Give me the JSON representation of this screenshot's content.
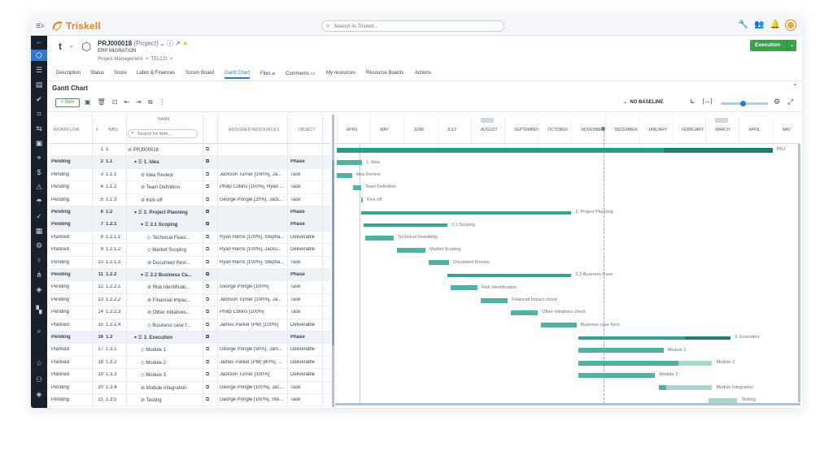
{
  "app": {
    "name": "Triskell",
    "search_placeholder": "Search in Triskell..."
  },
  "project": {
    "id": "PRJ000018",
    "type": "(Project)",
    "name": "ERP MIGRATION",
    "breadcrumbs": [
      "Project Management",
      "TELCO"
    ],
    "status_button": "Execution"
  },
  "tabs": [
    "Description",
    "Status",
    "Score",
    "Labor & Finances",
    "Scrum Board",
    "Gantt Chart",
    "Files",
    "Comments",
    "My resources",
    "Resource Boards",
    "Actions"
  ],
  "active_tab": "Gantt Chart",
  "section_title": "Gantt Chart",
  "toolbar": {
    "add_label": "+ Item",
    "baseline": "NO BASELINE"
  },
  "grid": {
    "headers": {
      "name": "NAME",
      "workflow": "WORKFLOW",
      "num": "#",
      "wbs": "WBS",
      "resources": "ASSIGNED RESOURCES",
      "object": "OBJECT"
    },
    "search_placeholder": "Search for item...",
    "rows": [
      {
        "workflow": "",
        "num": "1",
        "wbs": "1",
        "name": "PRJ000018",
        "resources": "",
        "object": "",
        "level": 0,
        "phase": false
      },
      {
        "workflow": "Pending",
        "num": "2",
        "wbs": "1.1",
        "name": "1. Idea",
        "resources": "",
        "object": "Phase",
        "level": 1,
        "phase": true
      },
      {
        "workflow": "Pending",
        "num": "3",
        "wbs": "1.1.1",
        "name": "Idea Review",
        "resources": "Jackson Turner [100%], Ja...",
        "object": "Task",
        "level": 2,
        "phase": false
      },
      {
        "workflow": "Pending",
        "num": "4",
        "wbs": "1.1.2",
        "name": "Team Definition",
        "resources": "Philip Collins [100%], Ryan ...",
        "object": "Task",
        "level": 2,
        "phase": false
      },
      {
        "workflow": "Pending",
        "num": "5",
        "wbs": "1.1.3",
        "name": "Kick-off",
        "resources": "George Pringle [20%], Jack...",
        "object": "Task",
        "level": 2,
        "phase": false
      },
      {
        "workflow": "Pending",
        "num": "6",
        "wbs": "1.2",
        "name": "2. Project Planning",
        "resources": "",
        "object": "Phase",
        "level": 1,
        "phase": true
      },
      {
        "workflow": "Pending",
        "num": "7",
        "wbs": "1.2.1",
        "name": "2.1 Scoping",
        "resources": "",
        "object": "Phase",
        "level": 2,
        "phase": true
      },
      {
        "workflow": "Planned",
        "num": "8",
        "wbs": "1.2.1.1",
        "name": "Technical Feasi...",
        "resources": "Ryan Harris [100%], Stepha...",
        "object": "Deliverable",
        "level": 3,
        "phase": false
      },
      {
        "workflow": "Planned",
        "num": "9",
        "wbs": "1.2.1.2",
        "name": "Market Scoping",
        "resources": "Ryan Harris [100%], Jacks...",
        "object": "Deliverable",
        "level": 3,
        "phase": false
      },
      {
        "workflow": "Pending",
        "num": "10",
        "wbs": "1.2.1.3",
        "name": "Document Revi...",
        "resources": "Ryan Harris [100%], Stepha...",
        "object": "Task",
        "level": 3,
        "phase": false
      },
      {
        "workflow": "Pending",
        "num": "11",
        "wbs": "1.2.2",
        "name": "2.2 Business Ca...",
        "resources": "",
        "object": "Phase",
        "level": 2,
        "phase": true
      },
      {
        "workflow": "Pending",
        "num": "12",
        "wbs": "1.2.2.1",
        "name": "Risk Identificati...",
        "resources": "George Pringle [100%]",
        "object": "Task",
        "level": 3,
        "phase": false
      },
      {
        "workflow": "Pending",
        "num": "13",
        "wbs": "1.2.2.2",
        "name": "Financial Impac...",
        "resources": "Jackson Turner [100%], Ja...",
        "object": "Task",
        "level": 3,
        "phase": false
      },
      {
        "workflow": "Pending",
        "num": "14",
        "wbs": "1.2.2.3",
        "name": "Other initiatives...",
        "resources": "Philip Collins [100%]",
        "object": "Task",
        "level": 3,
        "phase": false
      },
      {
        "workflow": "Planned",
        "num": "15",
        "wbs": "1.2.2.4",
        "name": "Business case f...",
        "resources": "James Parker (PM) [100%]",
        "object": "Deliverable",
        "level": 3,
        "phase": false
      },
      {
        "workflow": "Pending",
        "num": "16",
        "wbs": "1.3",
        "name": "3. Execution",
        "resources": "",
        "object": "Phase",
        "level": 1,
        "phase": true
      },
      {
        "workflow": "Planned",
        "num": "17",
        "wbs": "1.3.1",
        "name": "Module 1",
        "resources": "George Pringle [50%], Jam...",
        "object": "Deliverable",
        "level": 2,
        "phase": false
      },
      {
        "workflow": "Planned",
        "num": "18",
        "wbs": "1.3.2",
        "name": "Module 2",
        "resources": "James Parker (PM) [80%], ...",
        "object": "Deliverable",
        "level": 2,
        "phase": false
      },
      {
        "workflow": "Planned",
        "num": "19",
        "wbs": "1.3.3",
        "name": "Module 3",
        "resources": "Jackson Turner [100%]",
        "object": "Deliverable",
        "level": 2,
        "phase": false
      },
      {
        "workflow": "Pending",
        "num": "20",
        "wbs": "1.3.4",
        "name": "Module Integration",
        "resources": "George Pringle [100%], Jac...",
        "object": "Task",
        "level": 2,
        "phase": false
      },
      {
        "workflow": "Pending",
        "num": "21",
        "wbs": "1.3.5",
        "name": "Testing",
        "resources": "George Pringle [100%], Ste...",
        "object": "Task",
        "level": 2,
        "phase": false
      }
    ]
  },
  "gantt": {
    "months": [
      "APRIL",
      "MAY",
      "JUNE",
      "JULY",
      "AUGUST",
      "SEPTEMBER",
      "OCTOBER",
      "NOVEMBER",
      "DECEMBER",
      "JANUARY",
      "FEBRUARY",
      "MARCH",
      "APRIL",
      "MAY"
    ],
    "today_month_index": 7.95,
    "bars": [
      {
        "label": "PRJ",
        "start": 0.0,
        "end": 13.0,
        "kind": "proj",
        "progress": 0.25
      },
      {
        "label": "1. Idea",
        "start": 0.0,
        "end": 0.75,
        "kind": "task"
      },
      {
        "label": "Idea Review",
        "start": 0.0,
        "end": 0.45,
        "kind": "task"
      },
      {
        "label": "Team Definition",
        "start": 0.48,
        "end": 0.72,
        "kind": "task"
      },
      {
        "label": "Kick-off",
        "start": 0.72,
        "end": 0.78,
        "kind": "task"
      },
      {
        "label": "2. Project Planning",
        "start": 0.72,
        "end": 7.0,
        "kind": "sum"
      },
      {
        "label": "2.1 Scoping",
        "start": 0.8,
        "end": 3.3,
        "kind": "sum"
      },
      {
        "label": "Technical Feasibility",
        "start": 0.85,
        "end": 1.7,
        "kind": "task"
      },
      {
        "label": "Market Scoping",
        "start": 1.8,
        "end": 2.65,
        "kind": "task"
      },
      {
        "label": "Document Review",
        "start": 2.75,
        "end": 3.35,
        "kind": "task"
      },
      {
        "label": "2.2 Business Case",
        "start": 3.3,
        "end": 7.0,
        "kind": "sum"
      },
      {
        "label": "Risk Identification",
        "start": 3.4,
        "end": 4.2,
        "kind": "task"
      },
      {
        "label": "Financial Impact check",
        "start": 4.3,
        "end": 5.1,
        "kind": "task"
      },
      {
        "label": "Other initiatives check",
        "start": 5.2,
        "end": 6.0,
        "kind": "task"
      },
      {
        "label": "Business case form",
        "start": 6.1,
        "end": 7.15,
        "kind": "task"
      },
      {
        "label": "3. Execution",
        "start": 7.2,
        "end": 11.75,
        "kind": "sum",
        "progress": 0.3
      },
      {
        "label": "Module 1",
        "start": 7.2,
        "end": 9.75,
        "kind": "task"
      },
      {
        "label": "Module 2",
        "start": 7.2,
        "end": 11.2,
        "kind": "task",
        "rest": 0.25
      },
      {
        "label": "Module 3",
        "start": 7.2,
        "end": 9.5,
        "kind": "task"
      },
      {
        "label": "Module Integration",
        "start": 9.6,
        "end": 11.2,
        "kind": "task",
        "rest": 0.85
      },
      {
        "label": "Testing",
        "start": 11.1,
        "end": 11.95,
        "kind": "task",
        "rest": 1.0
      }
    ]
  }
}
